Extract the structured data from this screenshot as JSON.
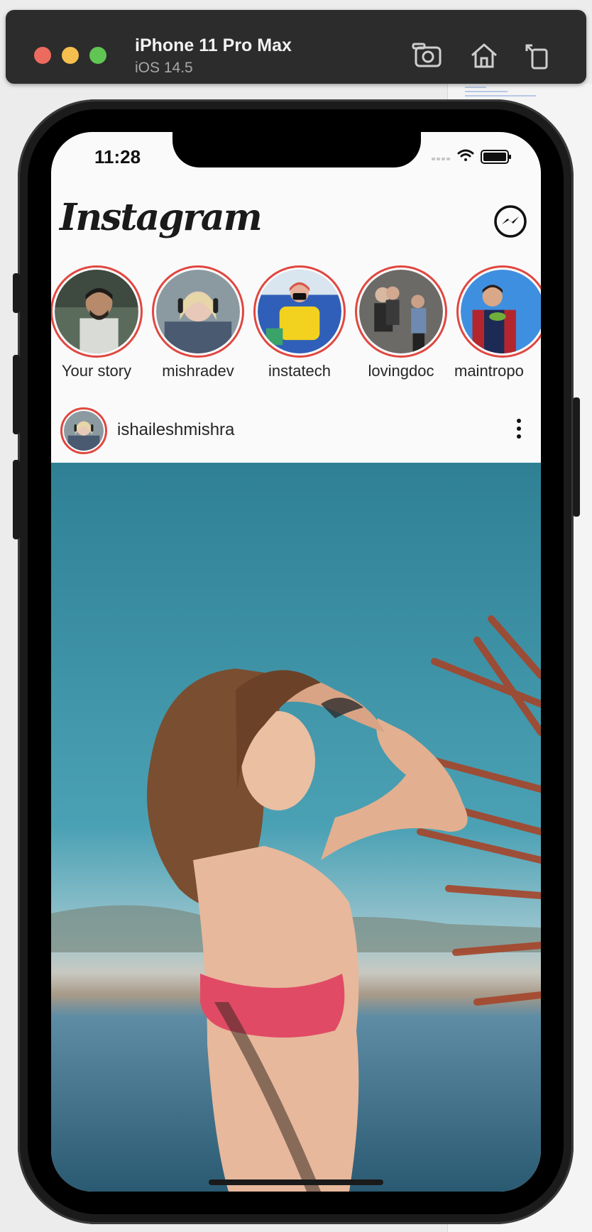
{
  "simulator": {
    "device_name": "iPhone 11 Pro Max",
    "os_version": "iOS 14.5"
  },
  "status_bar": {
    "time": "11:28"
  },
  "app": {
    "logo_text": "Instagram"
  },
  "stories": [
    {
      "name": "Your story"
    },
    {
      "name": "mishradev"
    },
    {
      "name": "instatech"
    },
    {
      "name": "lovingdoc"
    },
    {
      "name": "maintropo"
    }
  ],
  "post": {
    "username": "ishaileshmishra"
  },
  "colors": {
    "story_ring": "#e0473f",
    "background": "#fbfafb"
  }
}
